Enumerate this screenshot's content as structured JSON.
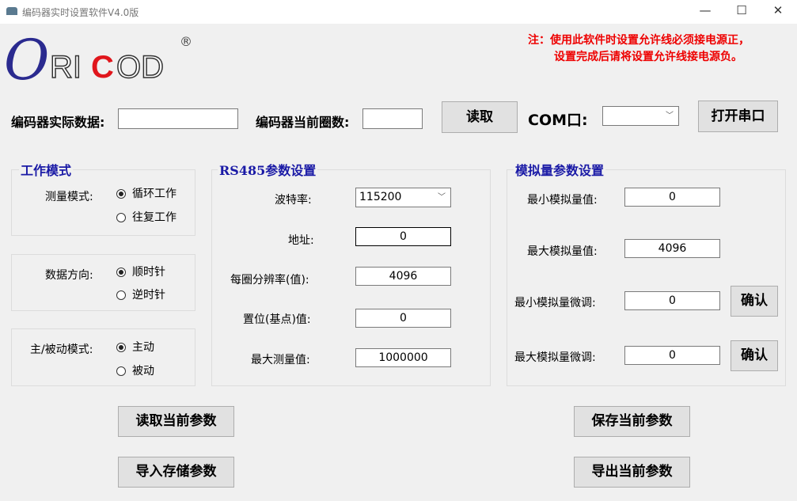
{
  "window": {
    "title": "编码器实时设置软件V4.0版",
    "minimize": "—",
    "maximize": "☐",
    "close": "✕"
  },
  "logo": {
    "text": "ORICOD",
    "registered": "®"
  },
  "note": {
    "line1": "注：使用此软件时设置允许线必须接电源正，",
    "line2": "设置完成后请将设置允许线接电源负。"
  },
  "top": {
    "actual_label": "编码器实际数据:",
    "actual_value": "",
    "turns_label": "编码器当前圈数:",
    "turns_value": "",
    "read_button": "读取",
    "com_label": "COM口:",
    "com_value": "",
    "open_port_button": "打开串口"
  },
  "work_mode": {
    "title": "工作模式",
    "measure_label": "测量模式:",
    "measure_options": [
      "循环工作",
      "往复工作"
    ],
    "direction_label": "数据方向:",
    "direction_options": [
      "顺时针",
      "逆时针"
    ],
    "master_label": "主/被动模式:",
    "master_options": [
      "主动",
      "被动"
    ]
  },
  "rs485": {
    "title": "RS485参数设置",
    "baud_label": "波特率:",
    "baud_value": "115200",
    "addr_label": "地址:",
    "addr_value": "0",
    "res_label": "每圈分辨率(值):",
    "res_value": "4096",
    "preset_label": "置位(基点)值:",
    "preset_value": "0",
    "max_label": "最大测量值:",
    "max_value": "1000000"
  },
  "analog": {
    "title": "模拟量参数设置",
    "min_label": "最小模拟量值:",
    "min_value": "0",
    "max_label": "最大模拟量值:",
    "max_value": "4096",
    "min_trim_label": "最小模拟量微调:",
    "min_trim_value": "0",
    "max_trim_label": "最大模拟量微调:",
    "max_trim_value": "0",
    "confirm": "确认"
  },
  "bottom": {
    "read_params": "读取当前参数",
    "import_params": "导入存储参数",
    "save_params": "保存当前参数",
    "export_params": "导出当前参数"
  }
}
